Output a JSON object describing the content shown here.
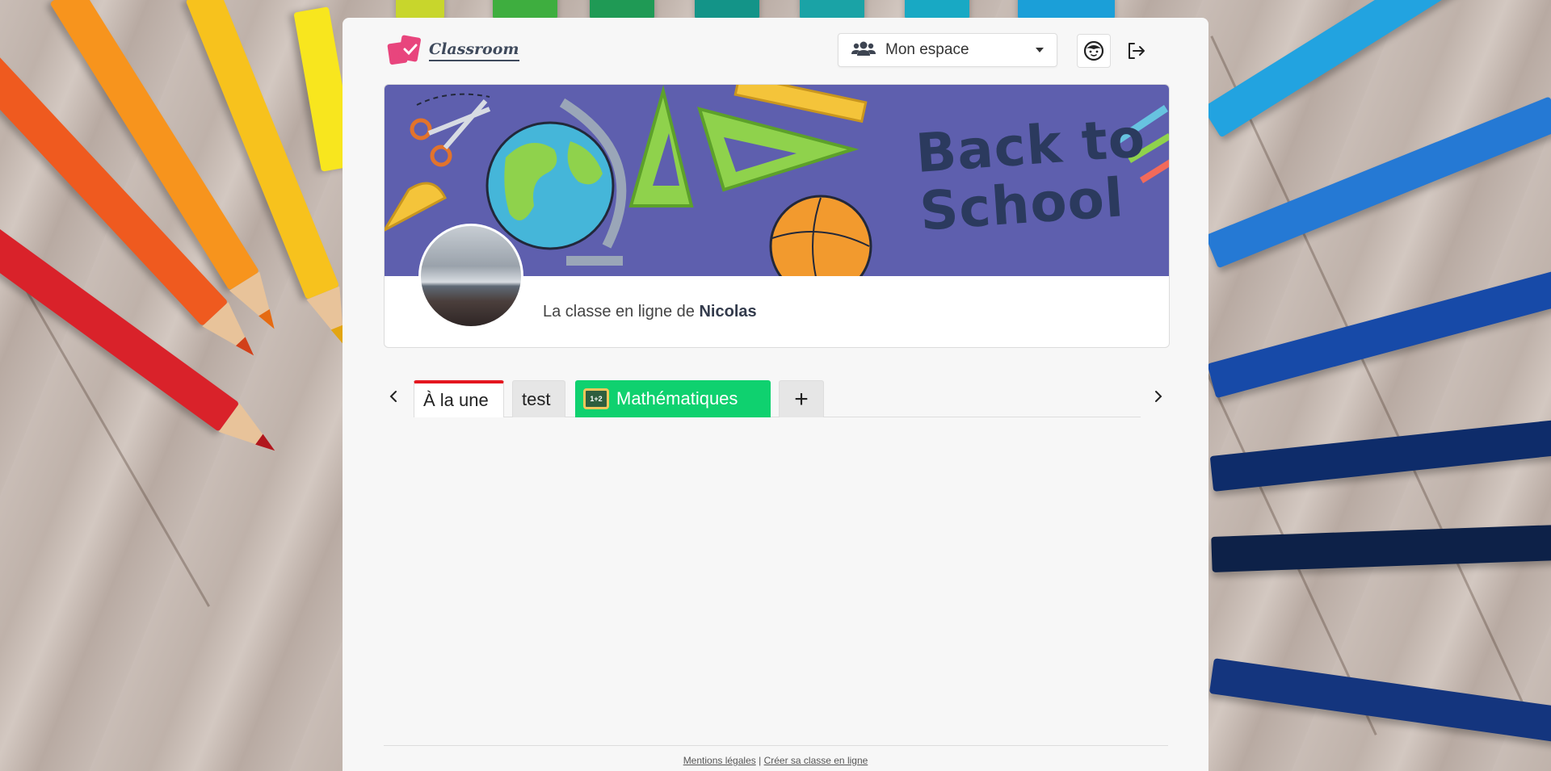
{
  "app": {
    "logo_text": "Classroom"
  },
  "header": {
    "space_selector": {
      "selected": "Mon espace"
    }
  },
  "banner": {
    "headline_line1": "Back to",
    "headline_line2": "School"
  },
  "class": {
    "title_prefix": "La classe en ligne de",
    "owner": "Nicolas"
  },
  "tabs": [
    {
      "label": "À la une",
      "active": true
    },
    {
      "label": "test"
    },
    {
      "label": "Mathématiques",
      "color": "#0fd16f"
    },
    {
      "label": "+"
    }
  ],
  "footer": {
    "legal_link": "Mentions légales",
    "separator": "|",
    "create_link": "Créer sa classe en ligne"
  },
  "colors": {
    "accent_red": "#e4161f",
    "math_green": "#0fd16f",
    "banner_bg": "#5e5fae",
    "logo_pink": "#e8457d"
  }
}
